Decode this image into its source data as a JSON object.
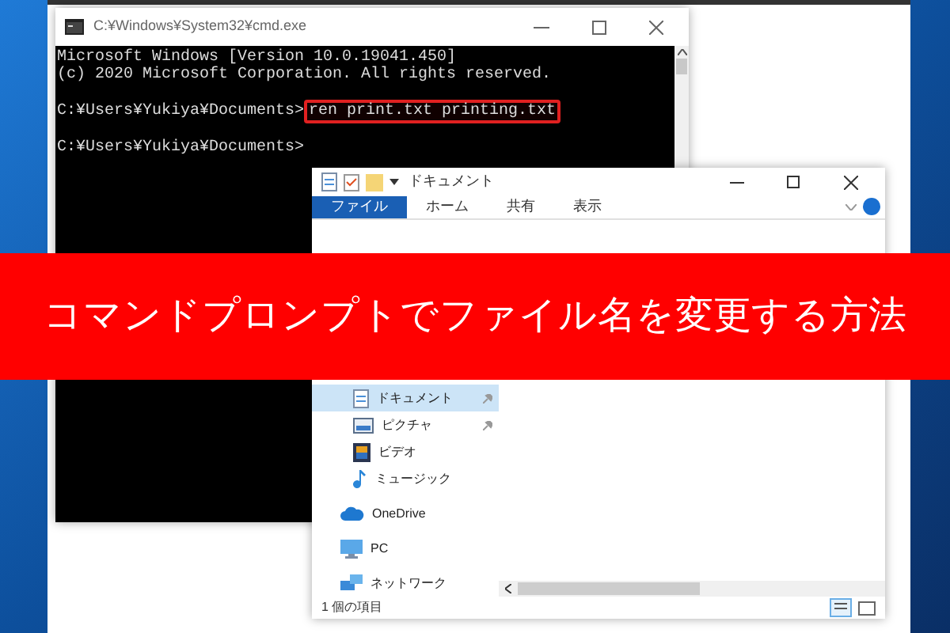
{
  "cmd_window": {
    "title": "C:¥Windows¥System32¥cmd.exe",
    "output": [
      "Microsoft Windows [Version 10.0.19041.450]",
      "(c) 2020 Microsoft Corporation. All rights reserved."
    ],
    "prompts": [
      {
        "prompt": "C:¥Users¥Yukiya¥Documents>",
        "command": "ren print.txt printing.txt",
        "highlighted": true
      },
      {
        "prompt": "C:¥Users¥Yukiya¥Documents>"
      }
    ]
  },
  "explorer": {
    "title": "ドキュメント",
    "ribbon_tabs": [
      {
        "label": "ファイル",
        "selected": true
      },
      {
        "label": "ホーム",
        "selected": false
      },
      {
        "label": "共有",
        "selected": false
      },
      {
        "label": "表示",
        "selected": false
      }
    ],
    "nav_items": [
      {
        "label": "ドキュメント",
        "kind": "documents",
        "selected": true,
        "pinned": true
      },
      {
        "label": "ピクチャ",
        "kind": "pictures",
        "selected": false,
        "pinned": true
      },
      {
        "label": "ビデオ",
        "kind": "videos",
        "selected": false,
        "pinned": false
      },
      {
        "label": "ミュージック",
        "kind": "music",
        "selected": false,
        "pinned": false
      },
      {
        "label": "OneDrive",
        "kind": "cloud",
        "selected": false,
        "pinned": false
      },
      {
        "label": "PC",
        "kind": "pc",
        "selected": false,
        "pinned": false
      },
      {
        "label": "ネットワーク",
        "kind": "network",
        "selected": false,
        "pinned": false
      }
    ],
    "status": "1 個の項目"
  },
  "banner": {
    "text": "コマンドプロンプトでファイル名を変更する方法"
  }
}
